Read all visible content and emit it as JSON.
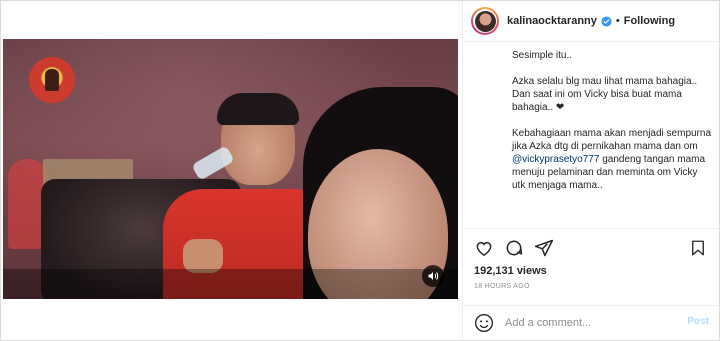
{
  "header": {
    "username": "kalinaocktaranny",
    "separator": "•",
    "follow_status": "Following"
  },
  "caption": {
    "line1": "Sesimple itu..",
    "para2": "Azka selalu blg mau lihat mama bahagia.. Dan saat ini om Vicky bisa buat mama bahagia.. ❤",
    "para3_before": "Kebahagiaan mama akan menjadi sempurna jika Azka dtg di pernikahan mama dan om ",
    "para3_mention": "@vickyprasetyo777",
    "para3_after": " gandeng tangan mama menuju pelaminan dan meminta om Vicky utk menjaga mama.."
  },
  "stats": {
    "views": "192,131 views",
    "time": "18 HOURS AGO"
  },
  "comment": {
    "placeholder": "Add a comment...",
    "post_label": "Post"
  },
  "colors": {
    "verified": "#3897f0",
    "post_disabled": "#b2dffc",
    "mention": "#00376b"
  },
  "icons": [
    "heart-icon",
    "comment-icon",
    "share-icon",
    "bookmark-icon",
    "emoji-icon",
    "sound-icon",
    "verified-icon"
  ]
}
